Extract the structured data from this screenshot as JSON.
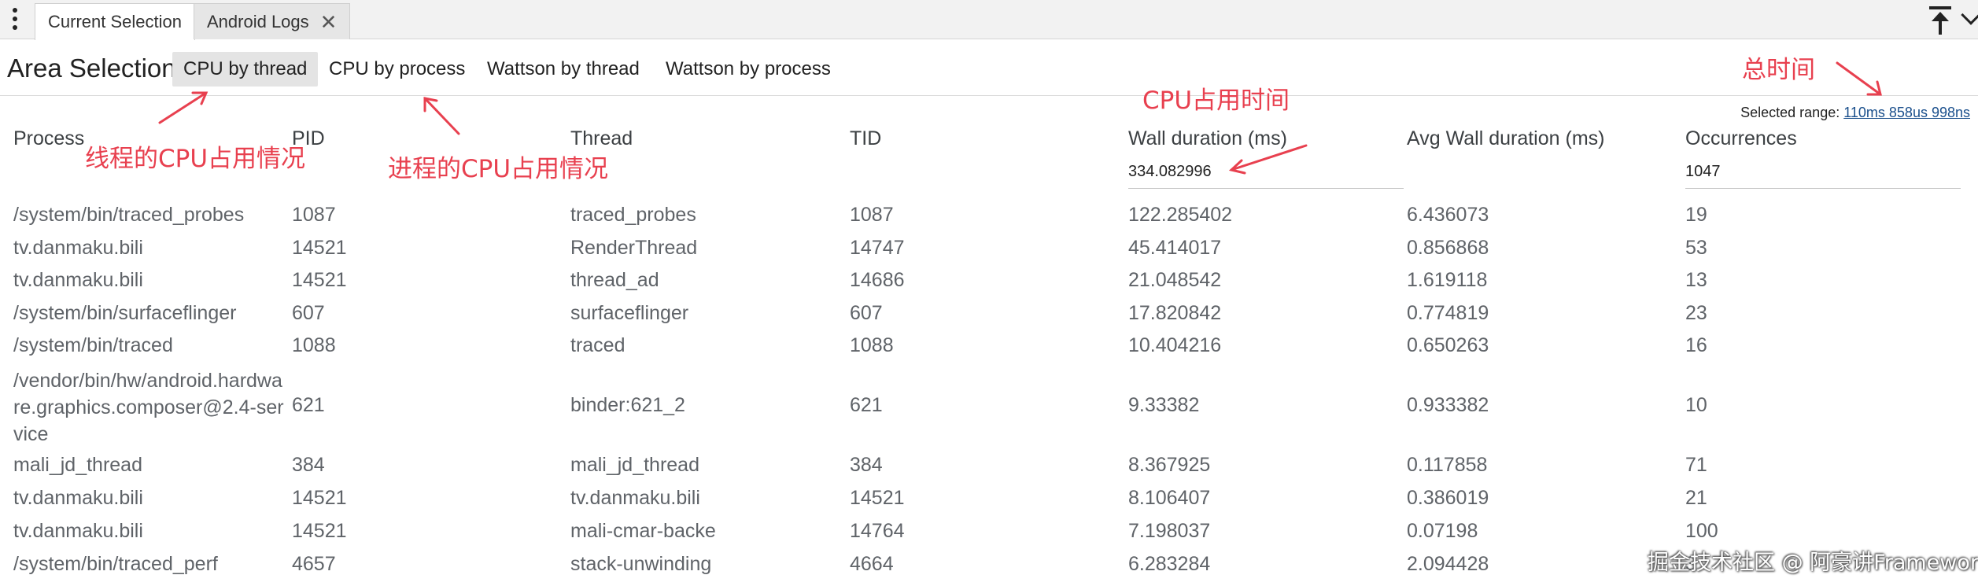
{
  "tabs": {
    "current_selection": "Current Selection",
    "android_logs": "Android Logs",
    "close_glyph": "✕"
  },
  "header": {
    "title": "Area Selection",
    "subtabs": [
      "CPU by thread",
      "CPU by process",
      "Wattson by thread",
      "Wattson by process"
    ],
    "active_subtab": "CPU by thread"
  },
  "selected_range": {
    "label": "Selected range: ",
    "value": "110ms 858us 998ns"
  },
  "table": {
    "columns": [
      "Process",
      "PID",
      "Thread",
      "TID",
      "Wall duration (ms)",
      "Avg Wall duration (ms)",
      "Occurrences"
    ],
    "totals": {
      "wall_duration": "334.082996",
      "occurrences": "1047"
    },
    "rows": [
      {
        "process": "/system/bin/traced_probes",
        "pid": "1087",
        "thread": "traced_probes",
        "tid": "1087",
        "wall": "122.285402",
        "avg": "6.436073",
        "occ": "19"
      },
      {
        "process": "tv.danmaku.bili",
        "pid": "14521",
        "thread": "RenderThread",
        "tid": "14747",
        "wall": "45.414017",
        "avg": "0.856868",
        "occ": "53"
      },
      {
        "process": "tv.danmaku.bili",
        "pid": "14521",
        "thread": "thread_ad",
        "tid": "14686",
        "wall": "21.048542",
        "avg": "1.619118",
        "occ": "13"
      },
      {
        "process": "/system/bin/surfaceflinger",
        "pid": "607",
        "thread": "surfaceflinger",
        "tid": "607",
        "wall": "17.820842",
        "avg": "0.774819",
        "occ": "23"
      },
      {
        "process": "/system/bin/traced",
        "pid": "1088",
        "thread": "traced",
        "tid": "1088",
        "wall": "10.404216",
        "avg": "0.650263",
        "occ": "16"
      },
      {
        "process": "/vendor/bin/hw/android.hardware.graphics.composer@2.4-service",
        "pid": "621",
        "thread": "binder:621_2",
        "tid": "621",
        "wall": "9.33382",
        "avg": "0.933382",
        "occ": "10"
      },
      {
        "process": "mali_jd_thread",
        "pid": "384",
        "thread": "mali_jd_thread",
        "tid": "384",
        "wall": "8.367925",
        "avg": "0.117858",
        "occ": "71"
      },
      {
        "process": "tv.danmaku.bili",
        "pid": "14521",
        "thread": "tv.danmaku.bili",
        "tid": "14521",
        "wall": "8.106407",
        "avg": "0.386019",
        "occ": "21"
      },
      {
        "process": "tv.danmaku.bili",
        "pid": "14521",
        "thread": "mali-cmar-backe",
        "tid": "14764",
        "wall": "7.198037",
        "avg": "0.07198",
        "occ": "100"
      },
      {
        "process": "/system/bin/traced_perf",
        "pid": "4657",
        "thread": "stack-unwinding",
        "tid": "4664",
        "wall": "6.283284",
        "avg": "2.094428",
        "occ": "3"
      }
    ]
  },
  "annotations": {
    "thread_cpu": "线程的CPU占用情况",
    "process_cpu": "进程的CPU占用情况",
    "cpu_time": "CPU占用时间",
    "total_time": "总时间",
    "color": "#e8404f"
  },
  "watermark": "掘金技术社区 @ 阿豪讲Framework"
}
